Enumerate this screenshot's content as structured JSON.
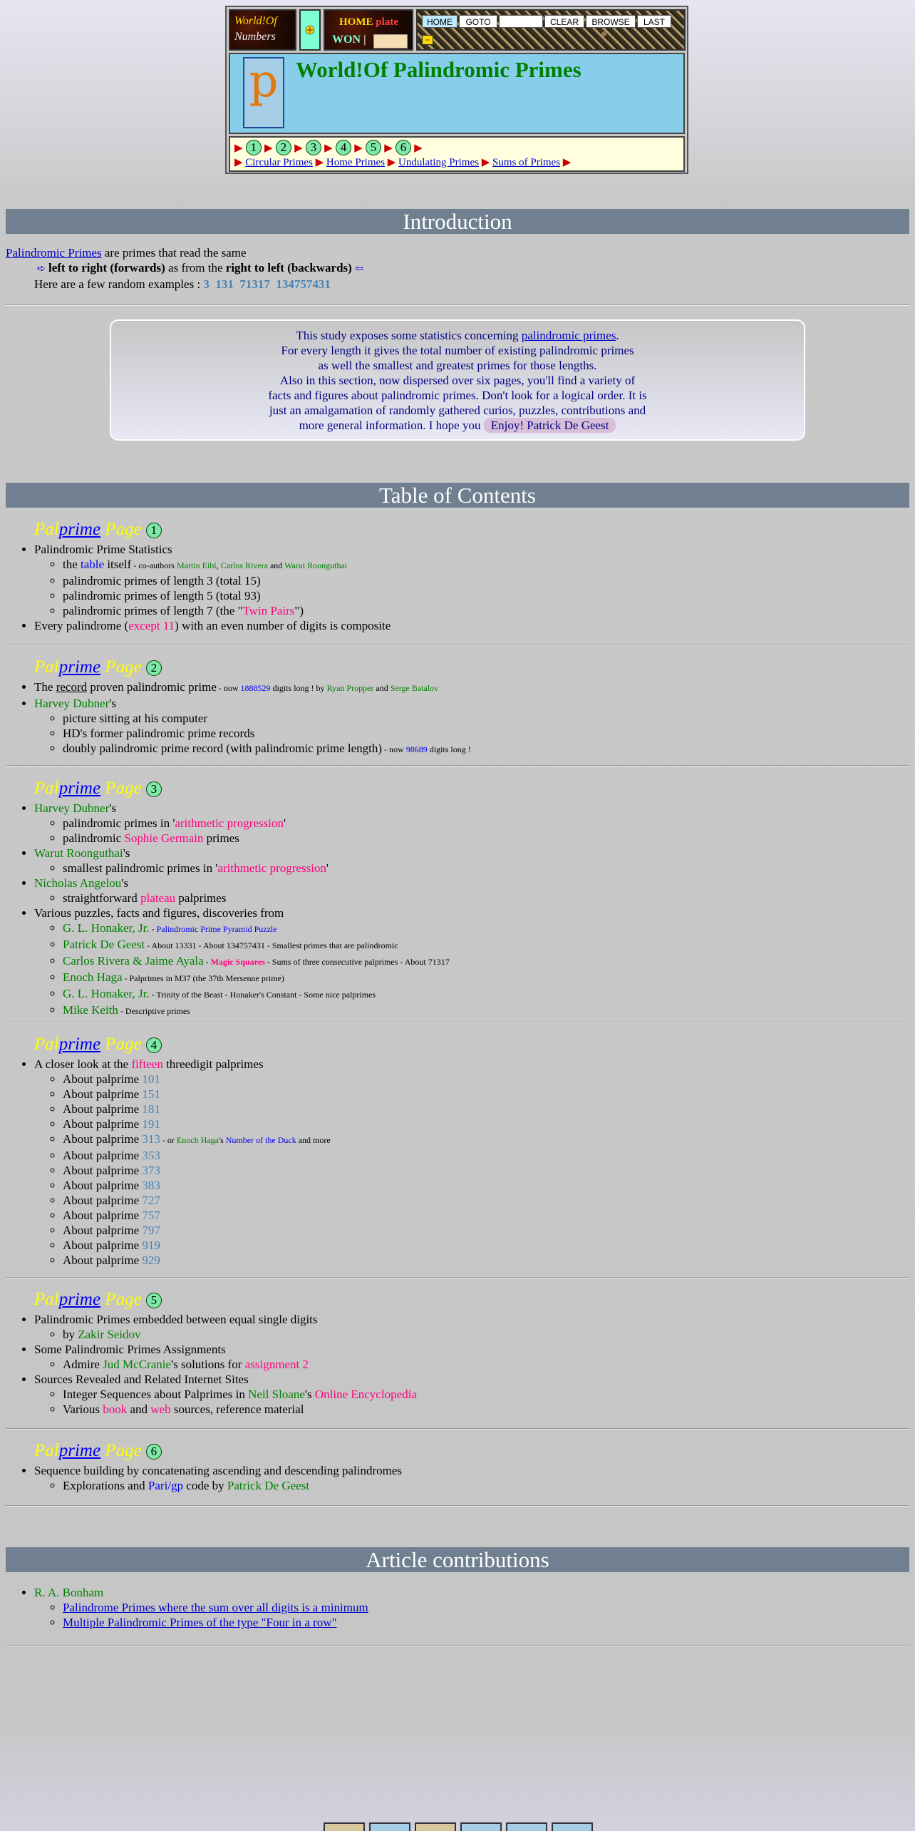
{
  "header": {
    "logo_line1": "World!Of",
    "logo_line2": "Numbers",
    "home_word": "HOME",
    "plate_word": "plate",
    "won_word": "WON",
    "nav": {
      "home": "HOME",
      "goto": "GOTO",
      "clear": "CLEAR",
      "browse": "BROWSE",
      "last": "LAST",
      "field_value": ""
    },
    "title": "World!Of Palindromic Primes",
    "page_numbers": [
      "1",
      "2",
      "3",
      "4",
      "5",
      "6"
    ],
    "links": [
      "Circular Primes",
      "Home Primes",
      "Undulating Primes",
      "Sums of Primes"
    ]
  },
  "intro": {
    "heading": "Introduction",
    "link": "Palindromic Primes",
    "line1_rest": " are primes that read the same",
    "forward": "left to right (forwards)",
    "as_from": " as from the ",
    "backward": "right to left (backwards)",
    "examples_label": "Here are a few random examples : ",
    "examples": [
      "3",
      "131",
      "71317",
      "134757431"
    ]
  },
  "study": {
    "line1_a": "This study exposes some statistics concerning ",
    "line1_link": "palindromic primes",
    "line1_b": ".",
    "line2": "For every length it gives the total number of existing palindromic primes",
    "line3": "as well the smallest and greatest primes for those lengths.",
    "line4": "Also in this section, now dispersed over six pages, you'll find a variety of",
    "line5": "facts and figures about palindromic primes. Don't look for a logical order. It is",
    "line6": "just an amalgamation of randomly gathered curios, puzzles, contributions and",
    "line7": "more general information. I hope you ",
    "enjoy": "Enjoy! Patrick De Geest"
  },
  "toc": {
    "heading": "Table of Contents",
    "head_pal": "Pal",
    "head_prime": "prime",
    "head_page": " Page ",
    "p1": {
      "num": "1",
      "stats": "Palindromic Prime Statistics",
      "table_a": "the ",
      "table_link": "table",
      "table_b": " itself",
      "coauthors": " - co-authors ",
      "author1": "Martin Eibl",
      "comma": ", ",
      "author2": "Carlos Rivera",
      "and": " and ",
      "author3": "Warut Roonguthai",
      "len3": "palindromic primes of length 3 (total 15)",
      "len5": "palindromic primes of length 5 (total 93)",
      "len7_a": "palindromic primes of length 7 (the \"",
      "len7_pink": "Twin Pairs",
      "len7_b": "\")",
      "every_a": "Every palindrome (",
      "every_pink": "except 11",
      "every_b": ") with an even number of digits is composite"
    },
    "p2": {
      "num": "2",
      "record_a": "The ",
      "record_u": "record",
      "record_b": " proven palindromic prime",
      "record_small_a": " - now ",
      "record_digits": "1888529",
      "record_small_b": " digits long ! by ",
      "r_author1": "Ryan Propper",
      "r_and": " and ",
      "r_author2": "Serge Batalov",
      "dubner": "Harvey Dubner",
      "dubner_s": "'s",
      "pic": "picture sitting at his computer",
      "former": "HD's former palindromic prime records",
      "doubly": "doubly palindromic prime record (with palindromic prime length)",
      "doubly_small_a": " - now ",
      "doubly_digits": "98689",
      "doubly_small_b": " digits long !"
    },
    "p3": {
      "num": "3",
      "dubner": "Harvey Dubner",
      "poss": "'s",
      "ap_a": "palindromic primes in '",
      "ap_pink": "arithmetic progression",
      "ap_b": "'",
      "sg_a": "palindromic ",
      "sg_pink": "Sophie Germain",
      "sg_b": " primes",
      "warut": "Warut Roonguthai",
      "smallest_a": "smallest palindromic primes in '",
      "smallest_pink": "arithmetic progression",
      "smallest_b": "'",
      "nicholas": "Nicholas Angelou",
      "plateau_a": "straightforward ",
      "plateau_pink": "plateau",
      "plateau_b": " palprimes",
      "various": "Various puzzles, facts and figures, discoveries from",
      "h1": "G. L. Honaker, Jr.",
      "h1_sep": " - ",
      "h1_link": "Palindromic Prime Pyramid Puzzle",
      "pdg": "Patrick De Geest",
      "pdg_small": " - About 13331 - About 134757431 - Smallest primes that are palindromic",
      "crja": "Carlos Rivera & Jaime Ayala",
      "crja_sep": " - ",
      "crja_pink": "Magic Squares",
      "crja_small": " - Sums of three consecutive palprimes - About 71317",
      "enoch": "Enoch Haga",
      "enoch_small": " - Palprimes in M37 (the 37th Mersenne prime)",
      "h2": "G. L. Honaker, Jr.",
      "h2_small": " - Trinity of the Beast - Honaker's Constant - Some nice palprimes",
      "mike": "Mike Keith",
      "mike_small": " - Descriptive primes"
    },
    "p4": {
      "num": "4",
      "closer_a": "A closer look at the ",
      "closer_pink": "fifteen",
      "closer_b": " threedigit palprimes",
      "about": "About palprime ",
      "values": [
        "101",
        "151",
        "181",
        "191",
        "313",
        "353",
        "373",
        "383",
        "727",
        "757",
        "797",
        "919",
        "929"
      ],
      "p313_a": " - or ",
      "p313_enoch": "Enoch Haga",
      "p313_s": "'s ",
      "p313_link": "Number of the Duck",
      "p313_b": " and more"
    },
    "p5": {
      "num": "5",
      "embedded": "Palindromic Primes embedded between equal single digits",
      "by": "by ",
      "zakir": "Zakir Seidov",
      "assign": "Some Palindromic Primes Assignments",
      "admire_a": "Admire ",
      "jud": "Jud McCranie",
      "admire_b": "'s solutions for ",
      "assign_pink": "assignment 2",
      "sources": "Sources Revealed and Related Internet Sites",
      "int_a": "Integer Sequences about Palprimes in ",
      "neil": "Neil Sloane",
      "int_s": "'s ",
      "oe_pink": "Online Encyclopedia",
      "var_a": "Various ",
      "book": "book",
      "var_and": " and ",
      "web": "web",
      "var_b": " sources, reference material"
    },
    "p6": {
      "num": "6",
      "seq": "Sequence building by concatenating ascending and descending palindromes",
      "expl_a": "Explorations and ",
      "parigp": "Pari/gp",
      "expl_b": " code by ",
      "pdg": "Patrick De Geest"
    }
  },
  "articles": {
    "heading": "Article contributions",
    "author": "R. A. Bonham",
    "link1": "Palindrome Primes where the sum over all digits is a minimum",
    "link2": "Multiple Palindromic Primes of the type \"Four in a row\""
  }
}
